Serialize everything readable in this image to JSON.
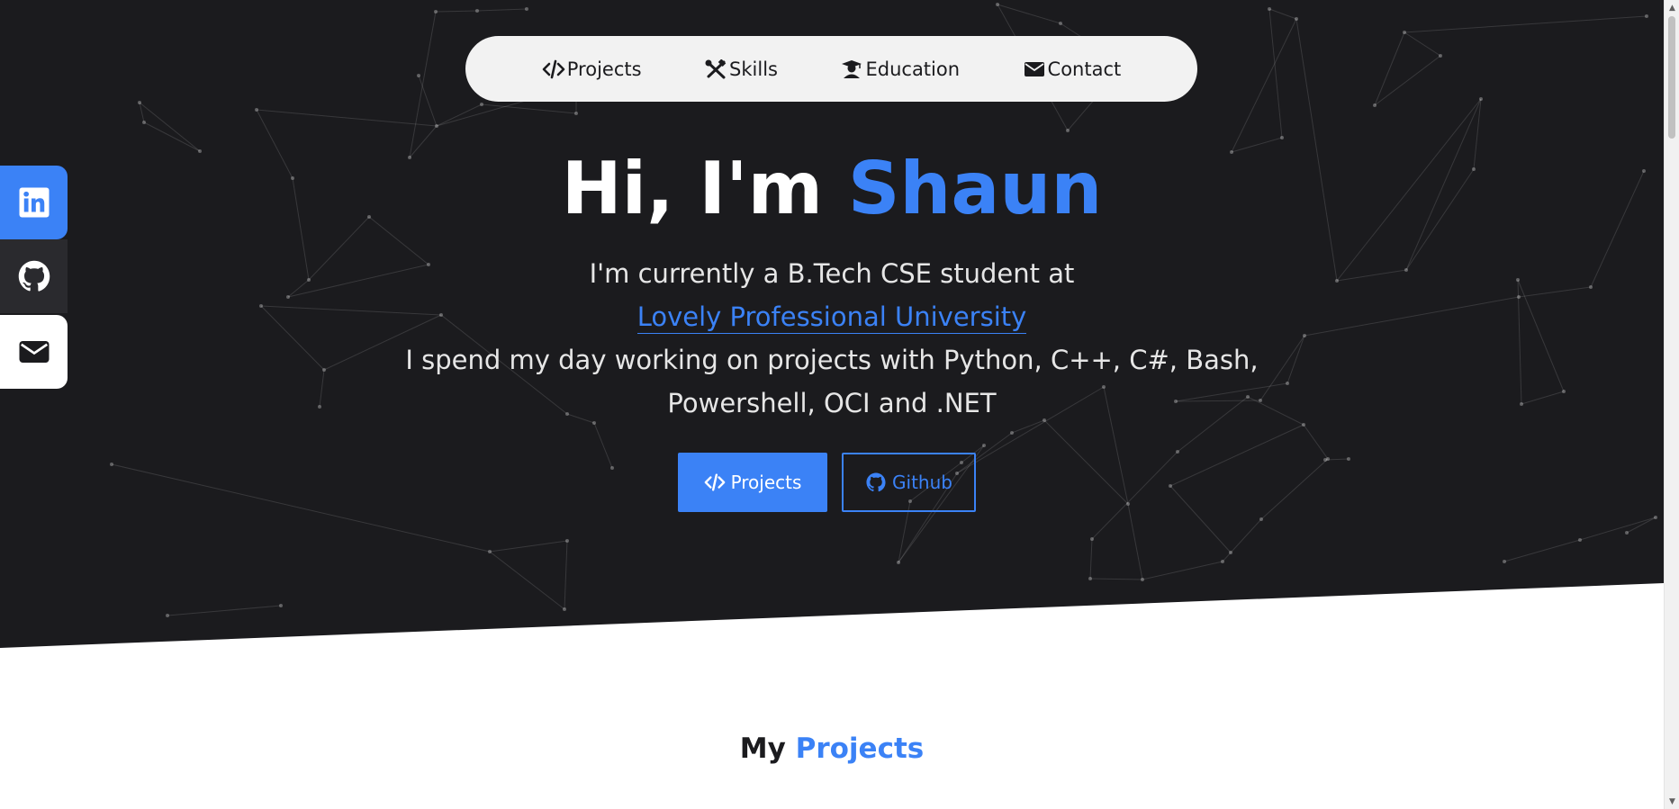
{
  "nav": {
    "items": [
      {
        "label": "Projects",
        "icon": "code-icon"
      },
      {
        "label": "Skills",
        "icon": "tools-icon"
      },
      {
        "label": "Education",
        "icon": "graduate-icon"
      },
      {
        "label": "Contact",
        "icon": "envelope-icon"
      }
    ]
  },
  "hero": {
    "greeting": "Hi, I'm",
    "name": "Shaun",
    "line1": "I'm currently a B.Tech CSE student at",
    "university": "Lovely Professional University",
    "line3": "I spend my day working on projects with Python, C++, C#, Bash,",
    "line4": "Powershell, OCI and .NET",
    "buttons": {
      "projects": "Projects",
      "github": "Github"
    }
  },
  "social": {
    "items": [
      "linkedin-icon",
      "github-icon",
      "envelope-icon"
    ]
  },
  "section": {
    "prefix": "My",
    "accent": "Projects"
  },
  "scrollbar": {
    "up_arrow": "▲",
    "down_arrow": "▼"
  },
  "colors": {
    "accent": "#3b82f6",
    "hero_bg": "#1b1b1e",
    "nav_bg": "#f2f2f2"
  }
}
